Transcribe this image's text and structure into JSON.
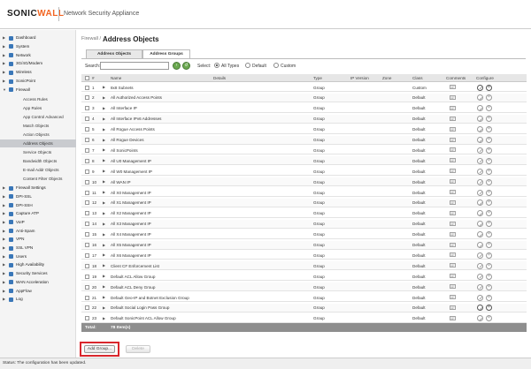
{
  "header": {
    "logo_text": "SONIC",
    "logo_text_accent": "WALL",
    "product": "Network Security Appliance"
  },
  "sidebar": {
    "items": [
      {
        "label": "Dashboard",
        "icon": "dashboard-icon"
      },
      {
        "label": "System",
        "icon": "system-icon"
      },
      {
        "label": "Network",
        "icon": "network-icon"
      },
      {
        "label": "3G/4G/Modem",
        "icon": "modem-icon"
      },
      {
        "label": "Wireless",
        "icon": "wireless-icon"
      },
      {
        "label": "SonicPoint",
        "icon": "sonicpoint-icon"
      },
      {
        "label": "Firewall",
        "icon": "firewall-icon"
      }
    ],
    "firewall_subitems": [
      "Access Rules",
      "App Rules",
      "App Control Advanced",
      "Match Objects",
      "Action Objects",
      "Address Objects",
      "Service Objects",
      "Bandwidth Objects",
      "E-mail Addr Objects",
      "Content Filter Objects"
    ],
    "active_subitem": "Address Objects",
    "items_after": [
      {
        "label": "Firewall Settings",
        "icon": "firewall-settings-icon"
      },
      {
        "label": "DPI-SSL",
        "icon": "dpi-ssl-icon"
      },
      {
        "label": "DPI-SSH",
        "icon": "dpi-ssh-icon"
      },
      {
        "label": "Capture ATP",
        "icon": "capture-atp-icon"
      },
      {
        "label": "VoIP",
        "icon": "voip-icon"
      },
      {
        "label": "Anti-Spam",
        "icon": "anti-spam-icon"
      },
      {
        "label": "VPN",
        "icon": "vpn-icon"
      },
      {
        "label": "SSL VPN",
        "icon": "ssl-vpn-icon"
      },
      {
        "label": "Users",
        "icon": "users-icon"
      },
      {
        "label": "High Availability",
        "icon": "high-availability-icon"
      },
      {
        "label": "Security Services",
        "icon": "security-services-icon"
      },
      {
        "label": "WAN Acceleration",
        "icon": "wan-acceleration-icon"
      },
      {
        "label": "AppFlow",
        "icon": "appflow-icon"
      },
      {
        "label": "Log",
        "icon": "log-icon"
      }
    ]
  },
  "page": {
    "breadcrumb": "Firewall /",
    "title": "Address Objects",
    "tabs": [
      "Address Objects",
      "Address Groups"
    ],
    "active_tab": "Address Groups"
  },
  "toolbar": {
    "search_label": "Search:",
    "search_value": "",
    "select_label": "Select:",
    "radio_options": [
      "All Types",
      "Default",
      "Custom"
    ],
    "selected_option": "All Types"
  },
  "table": {
    "columns": {
      "num": "#",
      "name": "Name",
      "details": "Details",
      "type": "Type",
      "ip_version": "IP Version",
      "zone": "Zone",
      "class": "Class",
      "comments": "Comments",
      "configure": "Configure"
    },
    "rows": [
      {
        "num": "1",
        "name": "8x8 Subnets",
        "type": "Group",
        "class": "Custom",
        "deletable": true
      },
      {
        "num": "2",
        "name": "All Authorized Access Points",
        "type": "Group",
        "class": "Default",
        "deletable": false
      },
      {
        "num": "3",
        "name": "All Interface IP",
        "type": "Group",
        "class": "Default",
        "deletable": false
      },
      {
        "num": "4",
        "name": "All Interface IPv6 Addresses",
        "type": "Group",
        "class": "Default",
        "deletable": false
      },
      {
        "num": "5",
        "name": "All Rogue Access Points",
        "type": "Group",
        "class": "Default",
        "deletable": false
      },
      {
        "num": "6",
        "name": "All Rogue Devices",
        "type": "Group",
        "class": "Default",
        "deletable": false
      },
      {
        "num": "7",
        "name": "All SonicPoints",
        "type": "Group",
        "class": "Default",
        "deletable": false
      },
      {
        "num": "8",
        "name": "All U0 Management IP",
        "type": "Group",
        "class": "Default",
        "deletable": false
      },
      {
        "num": "9",
        "name": "All W0 Management IP",
        "type": "Group",
        "class": "Default",
        "deletable": false
      },
      {
        "num": "10",
        "name": "All WAN IP",
        "type": "Group",
        "class": "Default",
        "deletable": false
      },
      {
        "num": "11",
        "name": "All X0 Management IP",
        "type": "Group",
        "class": "Default",
        "deletable": false
      },
      {
        "num": "12",
        "name": "All X1 Management IP",
        "type": "Group",
        "class": "Default",
        "deletable": false
      },
      {
        "num": "13",
        "name": "All X2 Management IP",
        "type": "Group",
        "class": "Default",
        "deletable": false
      },
      {
        "num": "14",
        "name": "All X3 Management IP",
        "type": "Group",
        "class": "Default",
        "deletable": false
      },
      {
        "num": "15",
        "name": "All X4 Management IP",
        "type": "Group",
        "class": "Default",
        "deletable": false
      },
      {
        "num": "16",
        "name": "All X5 Management IP",
        "type": "Group",
        "class": "Default",
        "deletable": false
      },
      {
        "num": "17",
        "name": "All X6 Management IP",
        "type": "Group",
        "class": "Default",
        "deletable": false
      },
      {
        "num": "18",
        "name": "Client CF Enforcement List",
        "type": "Group",
        "class": "Default",
        "deletable": false
      },
      {
        "num": "19",
        "name": "Default ACL Allow Group",
        "type": "Group",
        "class": "Default",
        "deletable": false
      },
      {
        "num": "20",
        "name": "Default ACL Deny Group",
        "type": "Group",
        "class": "Default",
        "deletable": false
      },
      {
        "num": "21",
        "name": "Default Geo-IP and Botnet Exclusion Group",
        "type": "Group",
        "class": "Default",
        "deletable": false
      },
      {
        "num": "22",
        "name": "Default Social Login Pass Group",
        "type": "Group",
        "class": "Default",
        "deletable": true
      },
      {
        "num": "23",
        "name": "Default SonicPoint ACL Allow Group",
        "type": "Group",
        "class": "Default",
        "deletable": false
      }
    ],
    "total_label": "Total:",
    "total_value": "78 Item(s)"
  },
  "actions": {
    "add_group": "Add Group...",
    "delete": "Delete"
  },
  "status": {
    "text": "Status: The configuration has been updated."
  },
  "colors": {
    "brand_accent": "#f26522",
    "highlight_box": "#d9262c",
    "total_bar": "#8e8e8e"
  }
}
